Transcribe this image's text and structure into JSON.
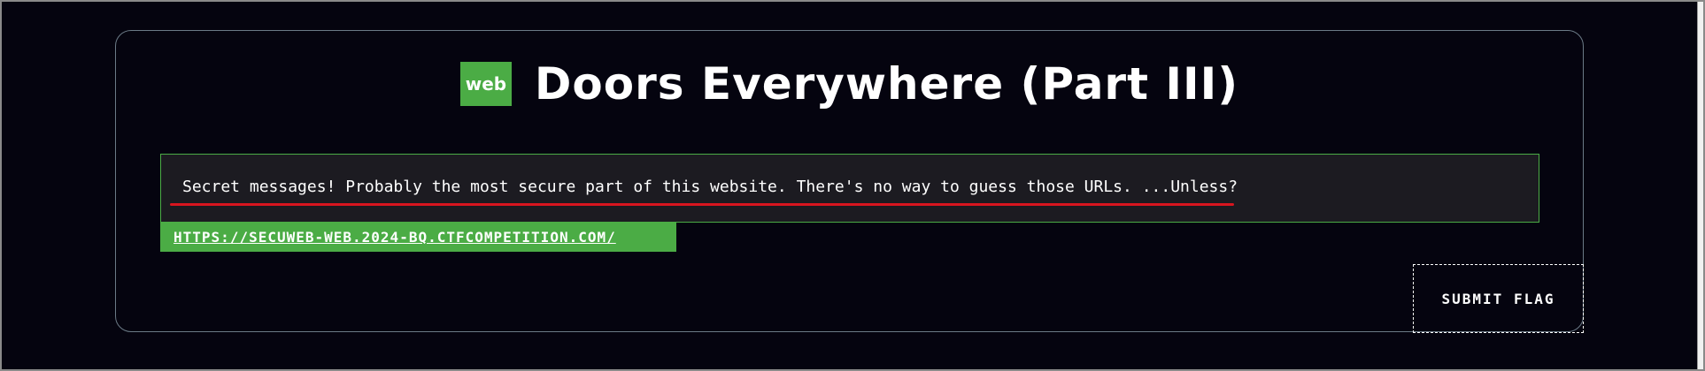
{
  "challenge": {
    "category_badge": "web",
    "title": "Doors Everywhere (Part III)",
    "description": "Secret messages! Probably the most secure part of this website. There's no way to guess those URLs. ...Unless?",
    "url": "HTTPS://SECUWEB-WEB.2024-BQ.CTFCOMPETITION.COM/",
    "submit_label": "SUBMIT FLAG"
  },
  "colors": {
    "background": "#05040f",
    "accent_green": "#4bac45",
    "underline_red": "#d8151f",
    "description_bg": "#1c1b21",
    "card_border": "#6b7a86"
  }
}
